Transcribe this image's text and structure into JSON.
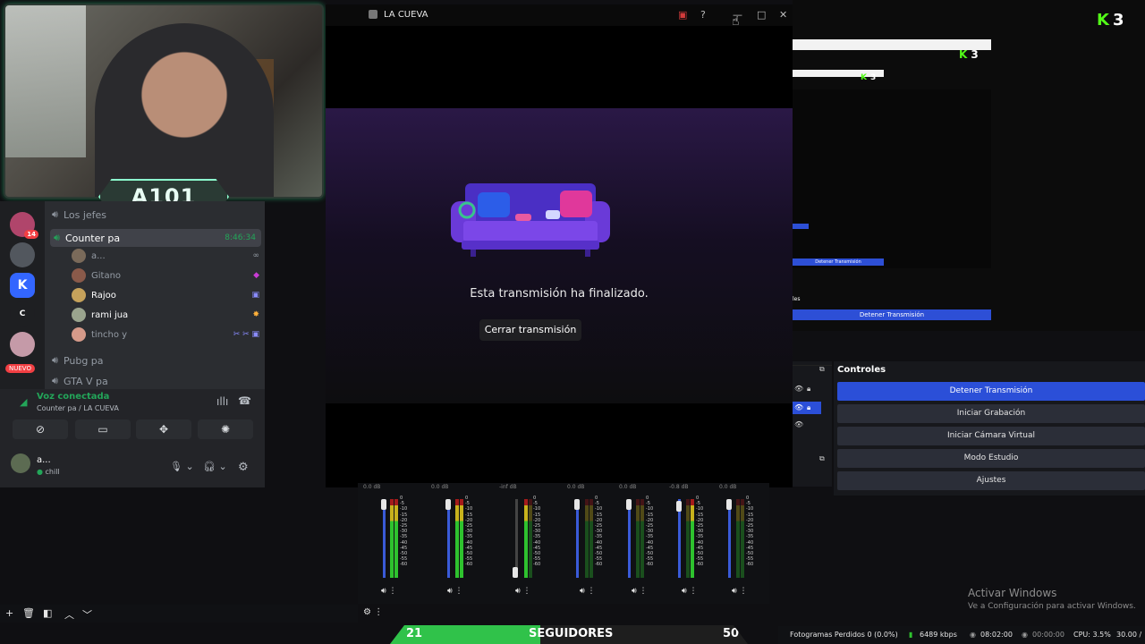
{
  "webcam": {
    "overlay_label": "A101"
  },
  "discord": {
    "servers": [
      {
        "label": "",
        "badge": "14",
        "color": "#b0456b"
      },
      {
        "label": "",
        "badge": "",
        "color": "#52575e"
      },
      {
        "label": "K",
        "badge": "",
        "color": "#3366ff"
      },
      {
        "label": "C",
        "badge": "",
        "color": "#1e1f22"
      },
      {
        "label": "",
        "badge": "",
        "color": "#c59aa8"
      }
    ],
    "new_badge": "NUEVO",
    "channels": {
      "first": "Los jefes",
      "active": "Counter pa",
      "active_timer": "8:46:34",
      "pubg": "Pubg pa",
      "gta": "GTA V pa"
    },
    "voice_users": [
      {
        "name": "a...",
        "status": "∞"
      },
      {
        "name": "Gitano",
        "status": "◆"
      },
      {
        "name": "Rajoo",
        "status": "▣"
      },
      {
        "name": "rami jua",
        "status": "✸"
      },
      {
        "name": "tincho y",
        "status": "✂ ✂ ▣"
      }
    ],
    "voice_panel": {
      "status": "Voz conectada",
      "location": "Counter pa / LA CUEVA",
      "user_name": "a...",
      "user_status": "chill"
    }
  },
  "modal": {
    "title": "LA CUEVA",
    "ended_message": "Esta transmisión ha finalizado.",
    "close_button": "Cerrar transmisión"
  },
  "preview": {
    "kick_count": "3",
    "stop_button_small": "Detener Transmisión",
    "les_label": "les",
    "stop_button_wide": "Detener Transmisión"
  },
  "controls": {
    "title": "Controles",
    "buttons": [
      "Detener Transmisión",
      "Iniciar Grabación",
      "Iniciar Cámara Virtual",
      "Modo Estudio",
      "Ajustes"
    ]
  },
  "mixer": {
    "strips": [
      {
        "db": "0.0 dB"
      },
      {
        "db": "0.0 dB"
      },
      {
        "db": "-inf dB"
      },
      {
        "db": "0.0 dB"
      },
      {
        "db": "0.0 dB"
      },
      {
        "db": "-0.8 dB"
      },
      {
        "db": "0.0 dB"
      }
    ],
    "scale": "0\n-5\n-10\n-15\n-20\n-25\n-30\n-35\n-40\n-45\n-50\n-55\n-60"
  },
  "followers": {
    "current": "21",
    "label": "SEGUIDORES",
    "goal": "50",
    "progress": 0.42
  },
  "status": {
    "dropped_frames": "Fotogramas Perdidos 0 (0.0%)",
    "bitrate": "6489 kbps",
    "stream_time": "08:02:00",
    "rec_time": "00:00:00",
    "cpu": "CPU: 3.5%",
    "fps": "30.00 /"
  },
  "windows_activation": {
    "title": "Activar Windows",
    "subtitle": "Ve a Configuración para activar Windows."
  }
}
